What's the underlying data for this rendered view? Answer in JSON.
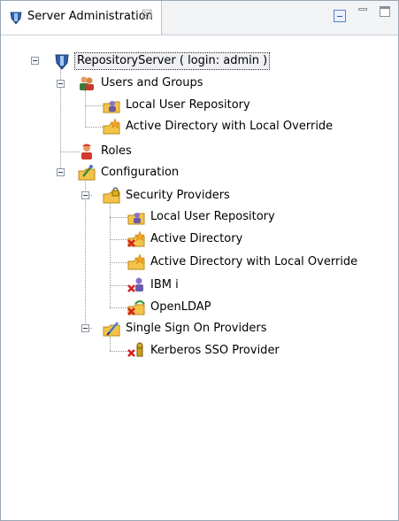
{
  "view": {
    "tab_title": "Server Administration",
    "close_glyph": "☒",
    "icons": {
      "tab": "server-shield-icon",
      "collapse": "collapse-all-icon",
      "minimize": "minimize-icon",
      "maximize": "maximize-icon"
    }
  },
  "tree": {
    "root": "RepositoryServer ( login: admin )",
    "users_groups": "Users and Groups",
    "ug_local": "Local User Repository",
    "ug_ad_override": "Active Directory with Local Override",
    "roles": "Roles",
    "configuration": "Configuration",
    "security_providers": "Security Providers",
    "sp_local": "Local User Repository",
    "sp_ad": "Active Directory",
    "sp_ad_override": "Active Directory with Local Override",
    "sp_ibmi": "IBM i",
    "sp_openldap": "OpenLDAP",
    "sso_providers": "Single Sign On Providers",
    "sso_kerberos": "Kerberos SSO Provider"
  },
  "colors": {
    "selection_border": "#333333",
    "folder": "#f3c44a",
    "error_x": "#d42020",
    "star": "#f5a623"
  }
}
